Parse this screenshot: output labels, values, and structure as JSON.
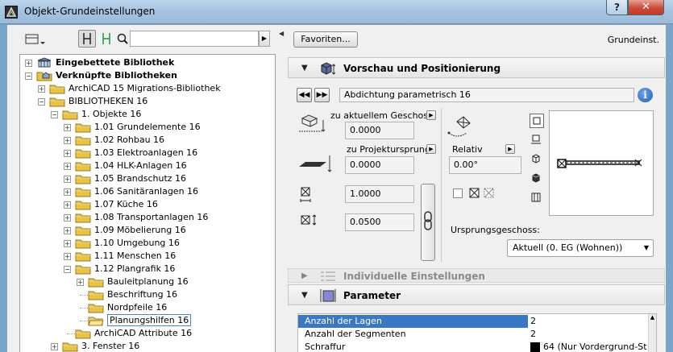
{
  "window": {
    "title": "Objekt-Grundeinstellungen",
    "help_label": "?",
    "close_label": "✕"
  },
  "left_panel": {
    "search": {
      "value": "",
      "placeholder": ""
    },
    "tree": [
      {
        "label": "Eingebettete Bibliothek",
        "level": 0,
        "expander": "+",
        "bold": true,
        "icon": "library-icon"
      },
      {
        "label": "Verknüpfte Bibliotheken",
        "level": 0,
        "expander": "−",
        "bold": true,
        "icon": "linked-library-icon"
      },
      {
        "label": "ArchiCAD 15 Migrations-Bibliothek",
        "level": 1,
        "expander": "+",
        "icon": "folder-icon"
      },
      {
        "label": "BIBLIOTHEKEN 16",
        "level": 1,
        "expander": "−",
        "icon": "folder-icon"
      },
      {
        "label": "1. Objekte 16",
        "level": 2,
        "expander": "−",
        "icon": "folder-icon"
      },
      {
        "label": "1.01 Grundelemente 16",
        "level": 3,
        "expander": "+",
        "icon": "folder-icon"
      },
      {
        "label": "1.02 Rohbau 16",
        "level": 3,
        "expander": "+",
        "icon": "folder-icon"
      },
      {
        "label": "1.03 Elektroanlagen 16",
        "level": 3,
        "expander": "+",
        "icon": "folder-icon"
      },
      {
        "label": "1.04 HLK-Anlagen 16",
        "level": 3,
        "expander": "+",
        "icon": "folder-icon"
      },
      {
        "label": "1.05 Brandschutz 16",
        "level": 3,
        "expander": "+",
        "icon": "folder-icon"
      },
      {
        "label": "1.06 Sanitäranlagen 16",
        "level": 3,
        "expander": "+",
        "icon": "folder-icon"
      },
      {
        "label": "1.07 Küche 16",
        "level": 3,
        "expander": "+",
        "icon": "folder-icon"
      },
      {
        "label": "1.08 Transportanlagen 16",
        "level": 3,
        "expander": "+",
        "icon": "folder-icon"
      },
      {
        "label": "1.09 Möbelierung 16",
        "level": 3,
        "expander": "+",
        "icon": "folder-icon"
      },
      {
        "label": "1.10 Umgebung 16",
        "level": 3,
        "expander": "+",
        "icon": "folder-icon"
      },
      {
        "label": "1.11 Menschen 16",
        "level": 3,
        "expander": "+",
        "icon": "folder-icon"
      },
      {
        "label": "1.12 Plangrafik 16",
        "level": 3,
        "expander": "−",
        "icon": "folder-icon"
      },
      {
        "label": "Bauleitplanung 16",
        "level": 4,
        "expander": "+",
        "icon": "folder-icon"
      },
      {
        "label": "Beschriftung 16",
        "level": 4,
        "expander": "",
        "icon": "folder-icon"
      },
      {
        "label": "Nordpfeile 16",
        "level": 4,
        "expander": "",
        "icon": "folder-icon"
      },
      {
        "label": "Planungshilfen 16",
        "level": 4,
        "expander": "",
        "icon": "open-folder-icon",
        "selected": true
      },
      {
        "label": "ArchiCAD Attribute 16",
        "level": 3,
        "expander": "",
        "icon": "folder-icon"
      },
      {
        "label": "3. Fenster 16",
        "level": 2,
        "expander": "+",
        "icon": "folder-icon"
      }
    ]
  },
  "right_panel": {
    "favorites_label": "Favoriten...",
    "grund_label": "Grundeinst.",
    "section_preview": {
      "title": "Vorschau und Positionierung",
      "expanded": true
    },
    "object_name": "Abdichtung parametrisch 16",
    "info_label": "i",
    "zu_aktuellem_geschoss": {
      "label": "zu aktuellem Geschoss",
      "value": "0.0000"
    },
    "zu_projektursprung": {
      "label": "zu Projektursprung",
      "value": "0.0000"
    },
    "size_a": "1.0000",
    "size_b": "0.0500",
    "relativ": {
      "label": "Relativ",
      "value": "0.00°"
    },
    "ursprungsgeschoss": {
      "label": "Ursprungsgeschoss:",
      "value": "Aktuell (0. EG (Wohnen))"
    },
    "section_individual": {
      "title": "Individuelle Einstellungen",
      "expanded": false
    },
    "section_parameter": {
      "title": "Parameter",
      "expanded": true
    },
    "parameters": [
      {
        "name": "Anzahl der Lagen",
        "value": "2",
        "selected": true
      },
      {
        "name": "Anzahl der Segmenten",
        "value": "2"
      },
      {
        "name": "Schraffur",
        "value": "64 (Nur Vordergrund-St",
        "swatch": "#000000"
      }
    ]
  },
  "colors": {
    "selection": "#3b78c4",
    "folder": "#e8c24a",
    "title_bar": "#a4c3df",
    "close_button": "#c23a27"
  }
}
